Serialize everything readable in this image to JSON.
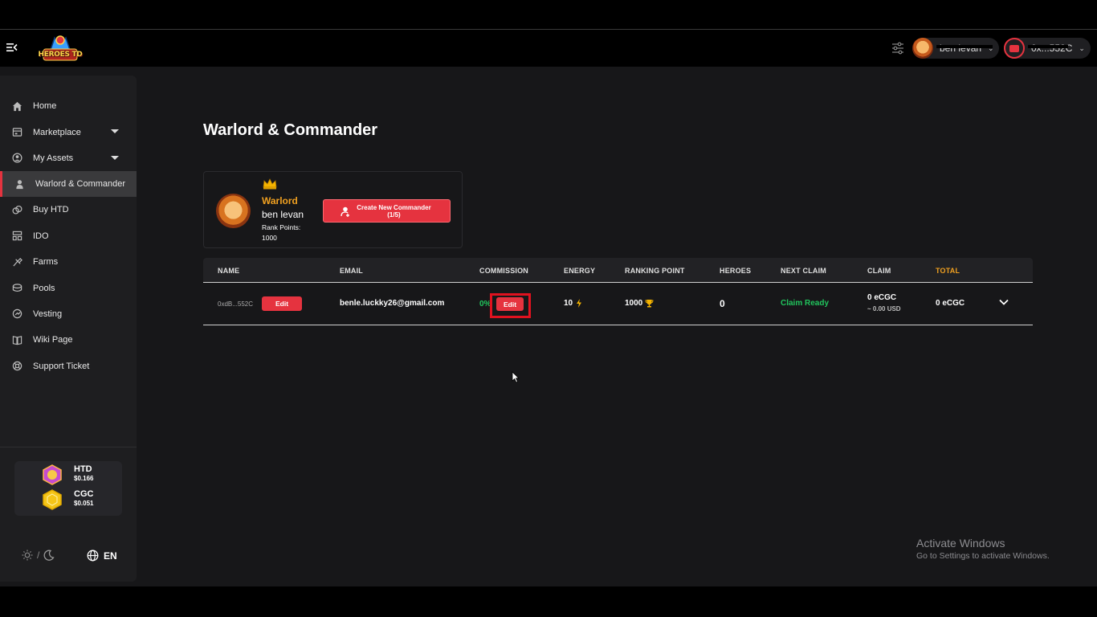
{
  "app": {
    "logo_text": "HEROES TD"
  },
  "header": {
    "user_name": "ben levan",
    "wallet_address": "0x...552C"
  },
  "sidebar": {
    "items": [
      {
        "label": "Home",
        "icon": "home-icon"
      },
      {
        "label": "Marketplace",
        "icon": "store-icon"
      },
      {
        "label": "My Assets",
        "icon": "user-circle-icon"
      },
      {
        "label": "Warlord & Commander",
        "icon": "person-icon"
      },
      {
        "label": "Buy HTD",
        "icon": "coins-icon"
      },
      {
        "label": "IDO",
        "icon": "grid-icon"
      },
      {
        "label": "Farms",
        "icon": "tractor-icon"
      },
      {
        "label": "Pools",
        "icon": "database-icon"
      },
      {
        "label": "Vesting",
        "icon": "vesting-icon"
      },
      {
        "label": "Wiki Page",
        "icon": "book-icon"
      },
      {
        "label": "Support Ticket",
        "icon": "lifebuoy-icon"
      }
    ],
    "tokens": [
      {
        "name": "HTD",
        "price": "$0.166"
      },
      {
        "name": "CGC",
        "price": "$0.051"
      }
    ],
    "theme_separator": "/",
    "language": "EN"
  },
  "main": {
    "title": "Warlord & Commander",
    "warlord": {
      "role": "Warlord",
      "name": "ben levan",
      "rank_label": "Rank Points:",
      "rank_value": "1000",
      "create_button_line1": "Create New Commander",
      "create_button_line2": "(1/5)"
    },
    "table": {
      "headers": [
        "NAME",
        "EMAIL",
        "COMMISSION",
        "ENERGY",
        "RANKING POINT",
        "HEROES",
        "NEXT CLAIM",
        "CLAIM",
        "TOTAL"
      ],
      "row": {
        "address": "0xdB...552C",
        "edit_label": "Edit",
        "email": "benle.luckky26@gmail.com",
        "commission": "0%",
        "commission_edit_label": "Edit",
        "energy": "10",
        "ranking_point": "1000",
        "heroes": "0",
        "next_claim": "Claim Ready",
        "claim": "0 eCGC",
        "claim_usd": "~ 0.00 USD",
        "total": "0 eCGC"
      }
    }
  },
  "watermark": {
    "title": "Activate Windows",
    "subtitle": "Go to Settings to activate Windows."
  },
  "colors": {
    "accent": "#e5333f",
    "gold": "#f0a020",
    "success": "#21c55d",
    "background": "#171719",
    "sidebar": "#1e1e20"
  }
}
